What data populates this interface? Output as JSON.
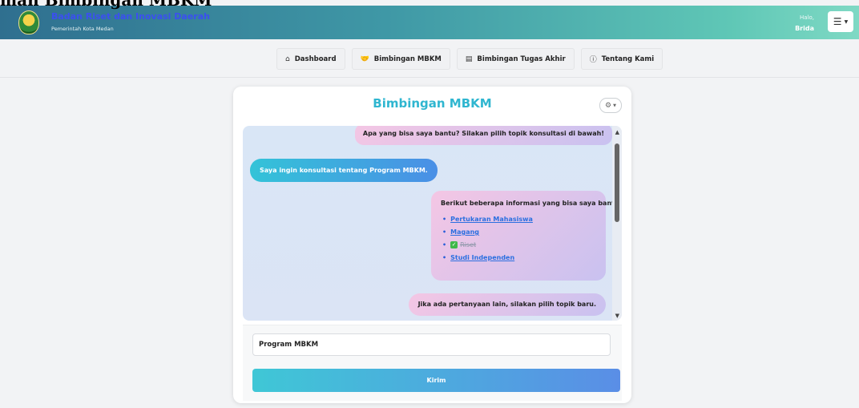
{
  "page": {
    "heading": "man Bimbingan MBKM"
  },
  "header": {
    "org_name": "Badan Riset dan Inovasi Daerah",
    "org_subtitle": "Pemerintah Kota Medan",
    "greeting": "Halo,",
    "user_name": "Brida",
    "menu_icon": "hamburger-icon"
  },
  "nav": [
    {
      "label": "Dashboard",
      "icon": "home-icon"
    },
    {
      "label": "Bimbingan MBKM",
      "icon": "handshake-icon"
    },
    {
      "label": "Bimbingan Tugas Akhir",
      "icon": "document-icon"
    },
    {
      "label": "Tentang Kami",
      "icon": "info-icon"
    }
  ],
  "card": {
    "title": "Bimbingan MBKM",
    "settings_icon": "gear-icon"
  },
  "chat": {
    "bot_intro": "Apa yang bisa saya bantu? Silakan pilih topik konsultasi di bawah!",
    "user_message": "Saya ingin konsultasi tentang Program MBKM.",
    "bot_info_heading": "Berikut beberapa informasi yang bisa saya bantu:",
    "topics": [
      {
        "label": "Pertukaran Mahasiswa",
        "done": false
      },
      {
        "label": "Magang",
        "done": false
      },
      {
        "label": "Riset",
        "done": true
      },
      {
        "label": "Studi Independen",
        "done": false
      }
    ],
    "bot_followup": "Jika ada pertanyaan lain, silakan pilih topik baru."
  },
  "input": {
    "value": "Program MBKM",
    "send_label": "Kirim"
  }
}
